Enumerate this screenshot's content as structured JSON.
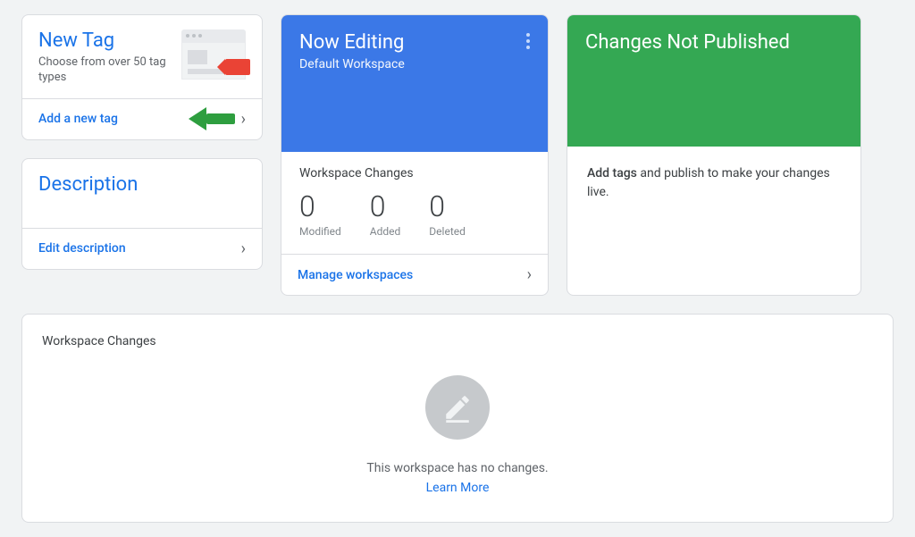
{
  "newtag": {
    "title": "New Tag",
    "subtitle": "Choose from over 50 tag types",
    "footer_link": "Add a new tag"
  },
  "description": {
    "title": "Description",
    "footer_link": "Edit description"
  },
  "now_editing": {
    "title": "Now Editing",
    "subtitle": "Default Workspace",
    "section_label": "Workspace Changes",
    "metrics": {
      "modified": {
        "value": "0",
        "label": "Modified"
      },
      "added": {
        "value": "0",
        "label": "Added"
      },
      "deleted": {
        "value": "0",
        "label": "Deleted"
      }
    },
    "footer_link": "Manage workspaces"
  },
  "changes_not_published": {
    "title": "Changes Not Published",
    "body_bold": "Add tags",
    "body_rest": " and publish to make your changes live."
  },
  "workspace_changes": {
    "title": "Workspace Changes",
    "empty_text": "This workspace has no changes.",
    "learn_more": "Learn More"
  }
}
